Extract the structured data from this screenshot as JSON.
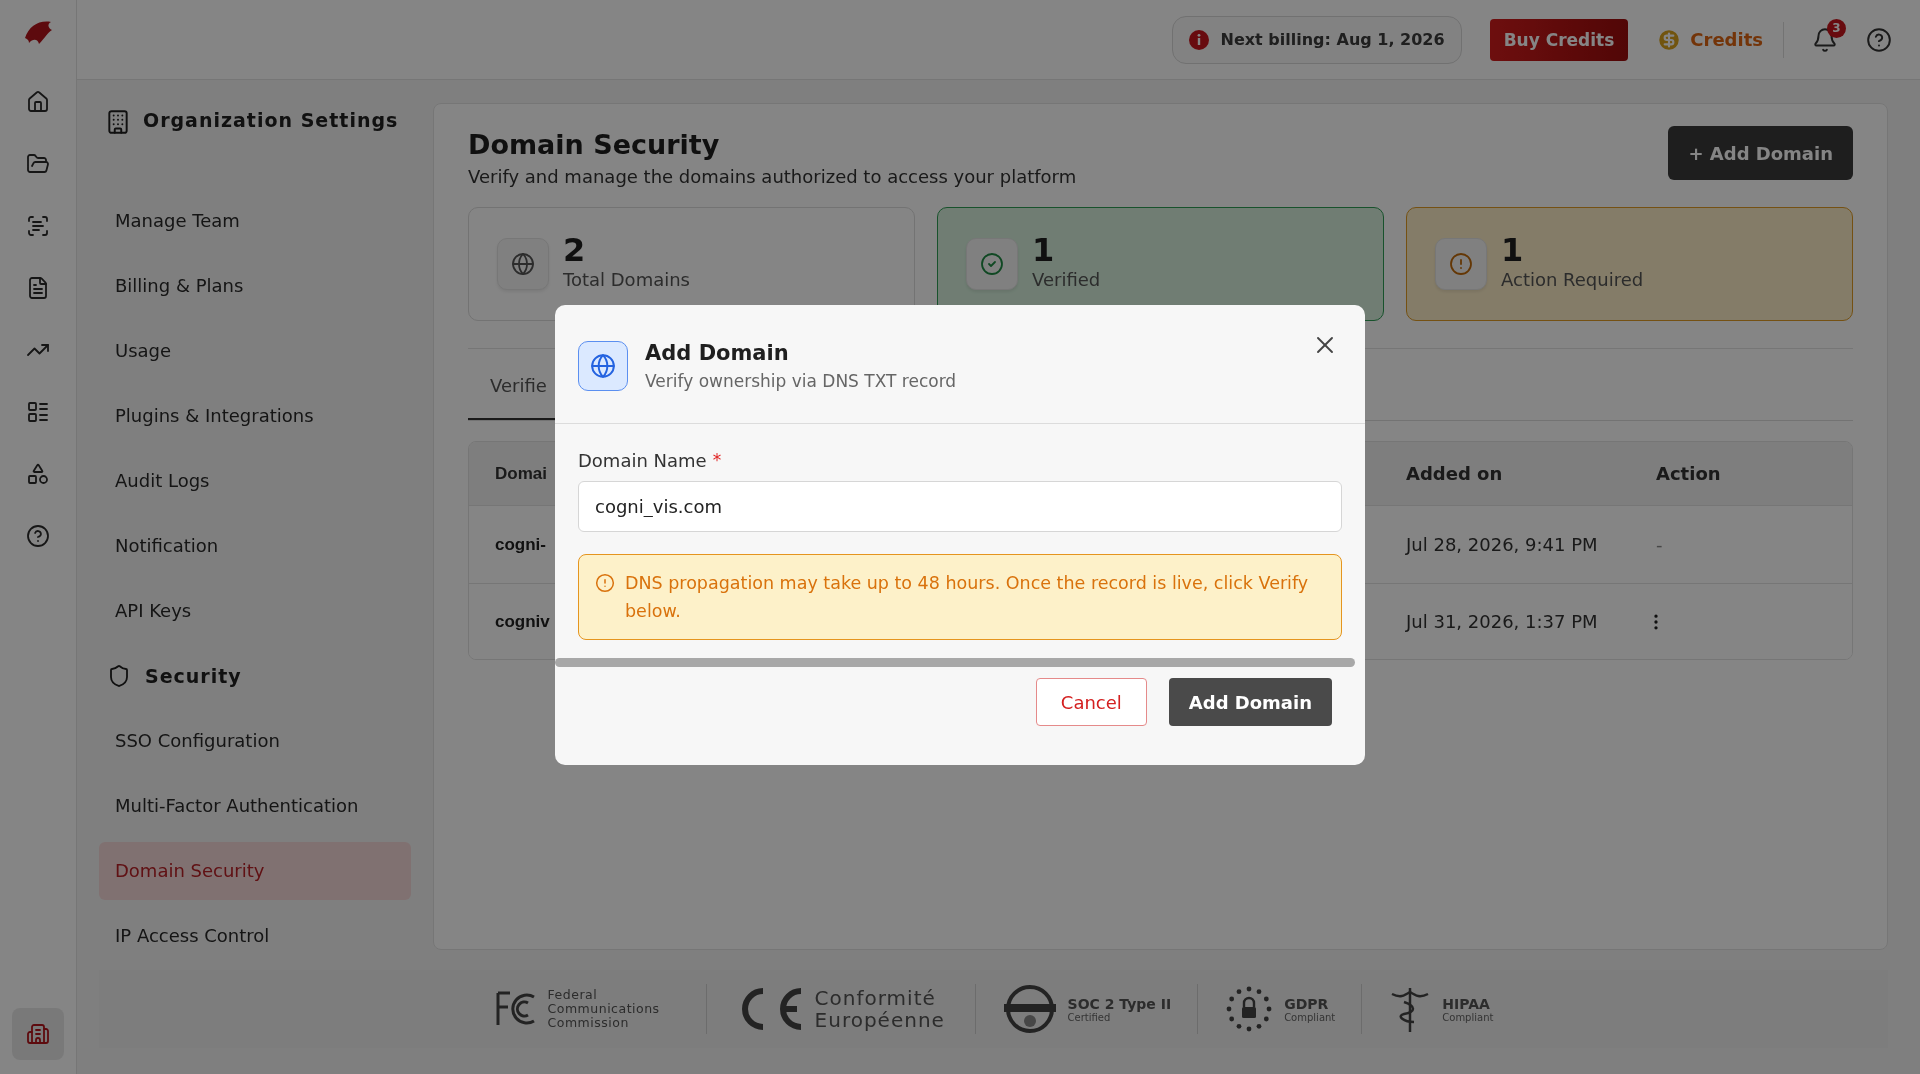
{
  "header": {
    "billing_notice": "Next billing: Aug 1, 2026",
    "buy_button": "Buy Credits",
    "credits_label": "Credits",
    "notification_count": "3"
  },
  "rail_items": [
    {
      "kind": "home",
      "selected": false
    },
    {
      "kind": "folder",
      "selected": false
    },
    {
      "kind": "scan",
      "selected": false
    },
    {
      "kind": "document",
      "selected": false
    },
    {
      "kind": "trend",
      "selected": false
    },
    {
      "kind": "list",
      "selected": false
    },
    {
      "kind": "shapes",
      "selected": false
    },
    {
      "kind": "help",
      "selected": false
    },
    {
      "kind": "organization",
      "selected": true
    }
  ],
  "sidebar": {
    "title": "Organization Settings",
    "sections": [
      {
        "items": [
          {
            "label": "Manage Team",
            "selected": false
          },
          {
            "label": "Billing & Plans",
            "selected": false
          },
          {
            "label": "Usage",
            "selected": false
          },
          {
            "label": "Plugins & Integrations",
            "selected": false
          },
          {
            "label": "Audit Logs",
            "selected": false
          },
          {
            "label": "Notification",
            "selected": false
          },
          {
            "label": "API Keys",
            "selected": false
          }
        ]
      },
      {
        "title": "Security",
        "items": [
          {
            "label": "SSO Configuration",
            "selected": false
          },
          {
            "label": "Multi-Factor Authentication",
            "selected": false
          },
          {
            "label": "Domain Security",
            "selected": true
          },
          {
            "label": "IP Access Control",
            "selected": false
          }
        ]
      }
    ]
  },
  "page": {
    "title": "Domain Security",
    "subtitle": "Verify and manage the domains authorized to access your platform",
    "add_button": "+ Add Domain"
  },
  "stats": [
    {
      "kind": "total",
      "value": "2",
      "label": "Total Domains"
    },
    {
      "kind": "verified",
      "value": "1",
      "label": "Verified"
    },
    {
      "kind": "action",
      "value": "1",
      "label": "Action Required"
    }
  ],
  "tabs": [
    {
      "label": "Verifie",
      "selected": true
    }
  ],
  "table": {
    "columns": [
      "Domai",
      "Added on",
      "Action"
    ],
    "rows": [
      {
        "domain": "cogni-",
        "added_on": "Jul 28, 2026, 9:41 PM",
        "action": {
          "kind": "text",
          "text": "-"
        }
      },
      {
        "domain": "cogniv",
        "added_on": "Jul 31, 2026, 1:37 PM",
        "action": {
          "kind": "menu"
        }
      }
    ]
  },
  "compliance": [
    {
      "kind": "fcc",
      "text": "Federal Communications Commission"
    },
    {
      "kind": "ce",
      "text": "Conformité Européenne"
    },
    {
      "kind": "soc",
      "title": "SOC 2 Type II",
      "subtitle": "Certified"
    },
    {
      "kind": "gdpr",
      "title": "GDPR",
      "subtitle": "Compliant"
    },
    {
      "kind": "hipaa",
      "title": "HIPAA",
      "subtitle": "Compliant"
    }
  ],
  "modal": {
    "title": "Add Domain",
    "subtitle": "Verify ownership via DNS TXT record",
    "field_label": "Domain Name",
    "required_mark": "*",
    "field_value": "cogni_vis.com",
    "warning": "DNS propagation may take up to 48 hours. Once the record is live, click Verify below.",
    "cancel_button": "Cancel",
    "confirm_button": "Add Domain"
  }
}
